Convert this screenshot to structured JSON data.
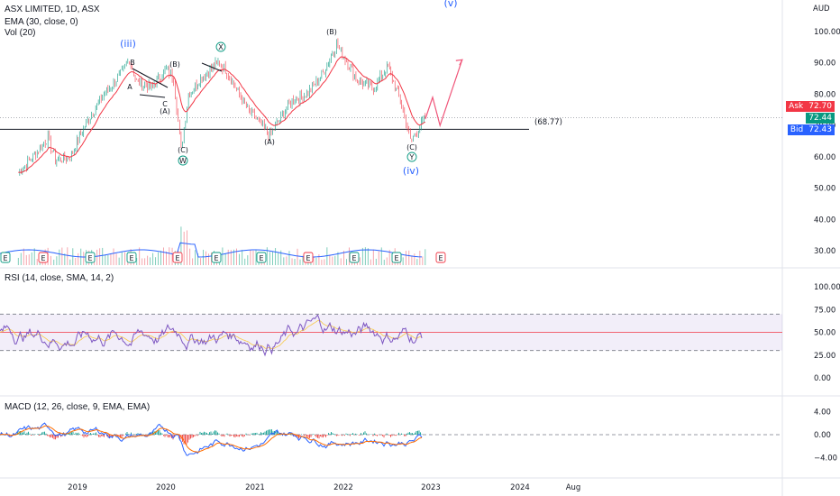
{
  "header": {
    "symbol_line": "ASX LIMITED, 1D, ASX",
    "ema_line": "EMA (30, close, 0)",
    "vol_line": "Vol (20)",
    "rsi_line": "RSI (14, close, SMA, 14, 2)",
    "macd_line": "MACD (12, 26, close, 9, EMA, EMA)"
  },
  "currency": "AUD",
  "price_tags": {
    "ask_label": "Ask",
    "ask_value": "72.70",
    "last_value": "72.44",
    "bid_label": "Bid",
    "bid_value": "72.43",
    "support_label": "(68.77)"
  },
  "colors": {
    "ask": "#f23645",
    "last": "#089981",
    "bid": "#2962ff",
    "price": "#089981",
    "ema": "#f23645",
    "rsi": "#7e57c2",
    "projection": "#f0567a",
    "wave": "#2962ff"
  },
  "chart_data": [
    {
      "type": "line",
      "title": "ASX LIMITED, 1D, ASX",
      "ylabel": "AUD",
      "x_ticks": [
        "2019",
        "2020",
        "2021",
        "2022",
        "2023",
        "2024",
        "Aug"
      ],
      "y_ticks": [
        "100.00",
        "90.00",
        "80.00",
        "70.00",
        "60.00",
        "50.00",
        "40.00",
        "30.00"
      ],
      "ylim": [
        25,
        102
      ],
      "series": [
        {
          "name": "EMA (30, close, 0)",
          "values": []
        }
      ],
      "price_points": [
        {
          "x": "2018-05",
          "y": 55
        },
        {
          "x": "2018-07",
          "y": 60
        },
        {
          "x": "2018-09",
          "y": 66
        },
        {
          "x": "2018-10",
          "y": 59
        },
        {
          "x": "2018-12",
          "y": 60
        },
        {
          "x": "2019-02",
          "y": 70
        },
        {
          "x": "2019-04",
          "y": 78
        },
        {
          "x": "2019-07",
          "y": 87
        },
        {
          "x": "2019-08",
          "y": 91
        },
        {
          "x": "2019-09",
          "y": 84
        },
        {
          "x": "2019-11",
          "y": 82
        },
        {
          "x": "2020-01",
          "y": 88
        },
        {
          "x": "2020-02",
          "y": 85
        },
        {
          "x": "2020-03",
          "y": 62
        },
        {
          "x": "2020-04",
          "y": 80
        },
        {
          "x": "2020-06",
          "y": 86
        },
        {
          "x": "2020-08",
          "y": 90
        },
        {
          "x": "2020-09",
          "y": 88
        },
        {
          "x": "2020-12",
          "y": 75
        },
        {
          "x": "2021-03",
          "y": 67
        },
        {
          "x": "2021-06",
          "y": 78
        },
        {
          "x": "2021-08",
          "y": 80
        },
        {
          "x": "2021-10",
          "y": 86
        },
        {
          "x": "2021-12",
          "y": 96
        },
        {
          "x": "2022-01",
          "y": 92
        },
        {
          "x": "2022-03",
          "y": 84
        },
        {
          "x": "2022-05",
          "y": 82
        },
        {
          "x": "2022-07",
          "y": 89
        },
        {
          "x": "2022-09",
          "y": 75
        },
        {
          "x": "2022-10",
          "y": 65
        },
        {
          "x": "2022-12",
          "y": 72.44
        }
      ],
      "horizontal_line": 68.77,
      "projection": [
        {
          "x": "2022-12",
          "y": 72
        },
        {
          "x": "2023-01",
          "y": 79
        },
        {
          "x": "2023-02",
          "y": 70
        },
        {
          "x": "2023-05",
          "y": 91
        }
      ],
      "wave_labels": [
        "(iii)",
        "(X)",
        "(B)",
        "(A)",
        "(C)",
        "(W)",
        "B",
        "A",
        "C",
        "(B)",
        "(A)",
        "(C)",
        "(Y)",
        "(iv)",
        "(v)"
      ]
    },
    {
      "type": "bar",
      "title": "Vol (20)",
      "note_markers": [
        "E",
        "E",
        "E",
        "E",
        "E",
        "E",
        "E",
        "E",
        "E",
        "E"
      ]
    },
    {
      "type": "line",
      "title": "RSI (14, close, SMA, 14, 2)",
      "y_ticks": [
        "100.00",
        "75.00",
        "50.00",
        "25.00",
        "0.00"
      ],
      "ylim": [
        0,
        100
      ],
      "bands": [
        30,
        70
      ]
    },
    {
      "type": "line",
      "title": "MACD (12, 26, close, 9, EMA, EMA)",
      "y_ticks": [
        "4.00",
        "0.00",
        "−4.00"
      ],
      "ylim": [
        -4.5,
        4.5
      ]
    }
  ]
}
